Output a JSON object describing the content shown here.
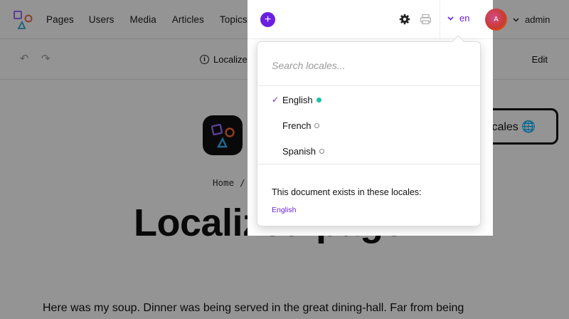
{
  "nav": {
    "items": [
      "Pages",
      "Users",
      "Media",
      "Articles",
      "Topics"
    ]
  },
  "toolbar": {
    "status_label": "Localized",
    "edit_label": "Edit"
  },
  "page": {
    "brand_partial": "A",
    "locales_button": "locales 🌐",
    "breadcrumb": {
      "home": "Home",
      "separator": "/",
      "current": "L"
    },
    "heading": "Localized page",
    "body_text": "Here was my soup. Dinner was being served in the great dining-hall. Far from being"
  },
  "header": {
    "add_icon": "plus-icon",
    "settings_icon": "gear-icon",
    "print_icon": "printer-icon",
    "locale_code": "en",
    "avatar_initial": "A",
    "user_name": "admin"
  },
  "locale_dropdown": {
    "search_placeholder": "Search locales...",
    "items": [
      {
        "label": "English",
        "selected": true,
        "exists": true
      },
      {
        "label": "French",
        "selected": false,
        "exists": false
      },
      {
        "label": "Spanish",
        "selected": false,
        "exists": false
      }
    ],
    "exists_label": "This document exists in these locales:",
    "exists_locales": [
      "English"
    ]
  },
  "colors": {
    "accent": "#6b1fe0",
    "exists_dot": "#19c3a3",
    "overlay": "rgba(0,0,0,0.42)"
  }
}
